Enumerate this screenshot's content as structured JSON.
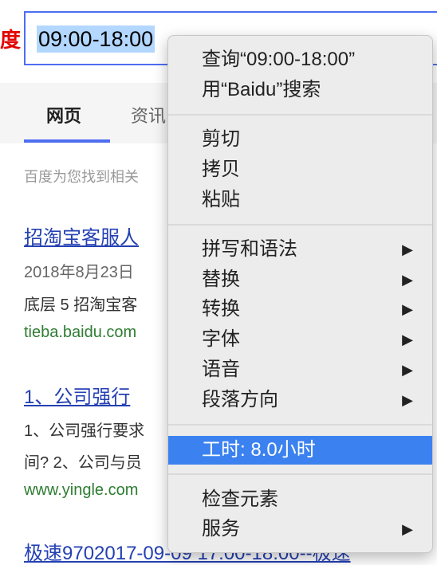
{
  "logo_text": "度",
  "search": {
    "value": "09:00-18:00"
  },
  "tabs": {
    "active": "网页",
    "other": "资讯"
  },
  "result_count_text": "百度为您找到相关",
  "results": [
    {
      "title": "招淘宝客服人",
      "date": "2018年8月23日",
      "abstract": "底层 5 招淘宝客",
      "url": "tieba.baidu.com"
    },
    {
      "title": "1、公司强行",
      "abstract1": "1、公司强行要求",
      "abstract2": "间? 2、公司与员",
      "url": "www.yingle.com"
    },
    {
      "title": "极速9702017-09-09 17:00-18:00--极速"
    }
  ],
  "menu": {
    "items": [
      {
        "label": "查询“09:00-18:00”",
        "submenu": false,
        "highlighted": false
      },
      {
        "label": "用“Baidu”搜索",
        "submenu": false,
        "highlighted": false
      },
      {
        "label": "剪切",
        "submenu": false,
        "highlighted": false
      },
      {
        "label": "拷贝",
        "submenu": false,
        "highlighted": false
      },
      {
        "label": "粘贴",
        "submenu": false,
        "highlighted": false
      },
      {
        "label": "拼写和语法",
        "submenu": true,
        "highlighted": false
      },
      {
        "label": "替换",
        "submenu": true,
        "highlighted": false
      },
      {
        "label": "转换",
        "submenu": true,
        "highlighted": false
      },
      {
        "label": "字体",
        "submenu": true,
        "highlighted": false
      },
      {
        "label": "语音",
        "submenu": true,
        "highlighted": false
      },
      {
        "label": "段落方向",
        "submenu": true,
        "highlighted": false
      },
      {
        "label": "工时: 8.0小时",
        "submenu": false,
        "highlighted": true
      },
      {
        "label": "检查元素",
        "submenu": false,
        "highlighted": false
      },
      {
        "label": "服务",
        "submenu": true,
        "highlighted": false
      }
    ],
    "arrow_glyph": "▶"
  },
  "colors": {
    "accent": "#4e6ef2",
    "highlight": "#3b82f0",
    "link": "#2440b3",
    "url": "#2e7d32"
  }
}
